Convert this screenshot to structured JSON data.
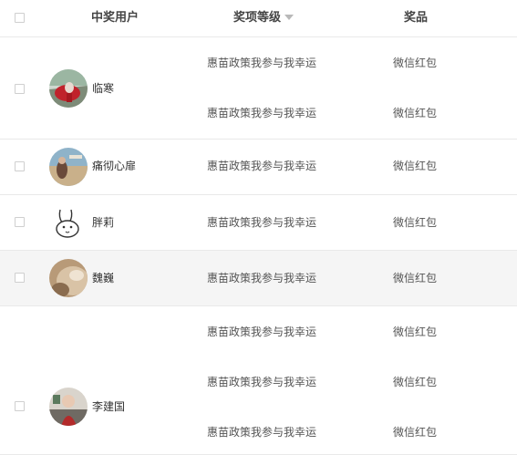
{
  "header": {
    "user": "中奖用户",
    "level": "奖项等级",
    "prize": "奖品"
  },
  "rows": [
    {
      "name": "临寒",
      "awards": [
        {
          "level": "惠苗政策我参与我幸运",
          "prize": "微信红包"
        },
        {
          "level": "惠苗政策我参与我幸运",
          "prize": "微信红包"
        }
      ]
    },
    {
      "name": "痛彻心扉",
      "awards": [
        {
          "level": "惠苗政策我参与我幸运",
          "prize": "微信红包"
        }
      ]
    },
    {
      "name": "胖莉",
      "awards": [
        {
          "level": "惠苗政策我参与我幸运",
          "prize": "微信红包"
        }
      ]
    },
    {
      "name": "魏巍",
      "awards": [
        {
          "level": "惠苗政策我参与我幸运",
          "prize": "微信红包"
        }
      ]
    },
    {
      "name": "李建国",
      "awards": [
        {
          "level": "惠苗政策我参与我幸运",
          "prize": "微信红包"
        },
        {
          "level": "惠苗政策我参与我幸运",
          "prize": "微信红包"
        },
        {
          "level": "惠苗政策我参与我幸运",
          "prize": "微信红包"
        }
      ]
    }
  ]
}
